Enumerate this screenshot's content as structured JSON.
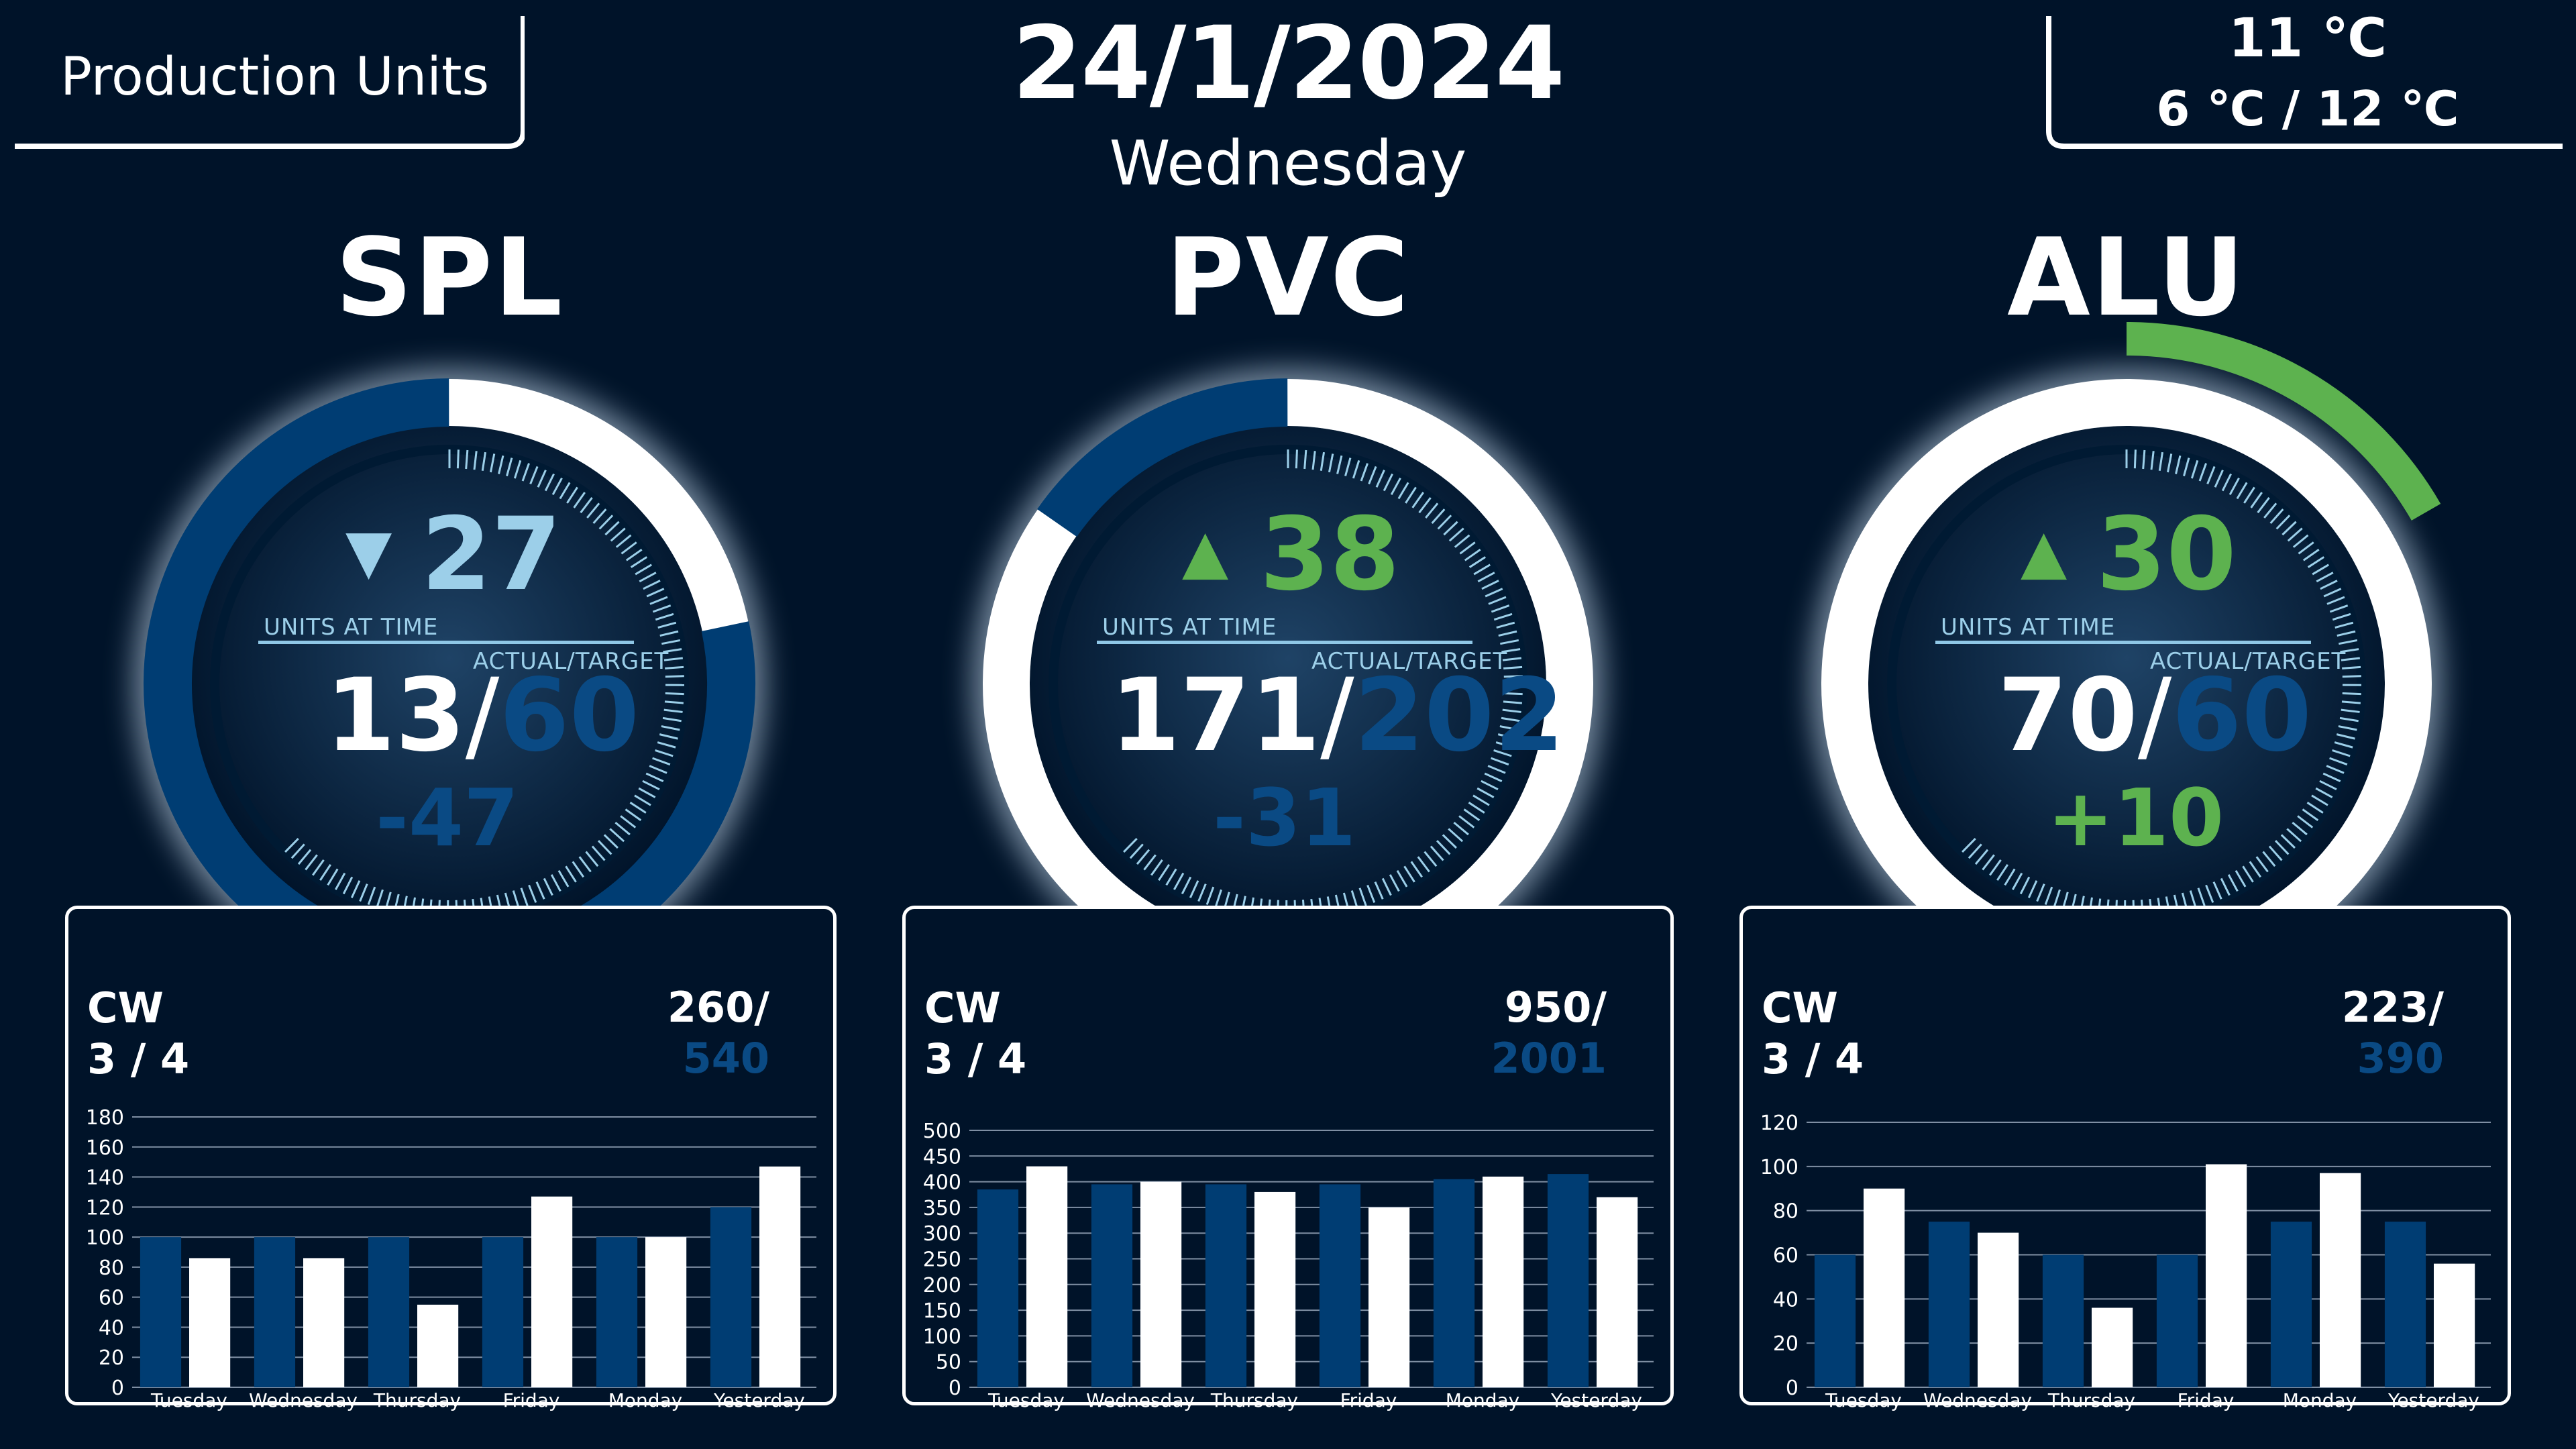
{
  "header": {
    "title": "Production Units",
    "date": "24/1/2024",
    "weekday": "Wednesday",
    "weather": {
      "current": "11 ℃",
      "range": "6 ℃ / 12 ℃"
    }
  },
  "colors": {
    "background": "#001329",
    "navy_bar": "#003d73",
    "white": "#ffffff",
    "light_blue": "#9ccfe9",
    "target_blue": "#0a4a84",
    "green": "#5db24f"
  },
  "units": [
    {
      "name": "SPL",
      "trend_icon": "triangle-down-icon",
      "trend": "down",
      "units_at_time": "27",
      "units_at_time_label": "UNITS AT TIME",
      "actual_target_label": "ACTUAL/TARGET",
      "actual": "13",
      "slash": "/",
      "target": "60",
      "difference": "-47",
      "progress_fraction": 0.217,
      "cw_label": "CW",
      "cw_value": "3 / 4",
      "week_actual": "260/",
      "week_target": "540"
    },
    {
      "name": "PVC",
      "trend_icon": "triangle-up-icon",
      "trend": "up",
      "units_at_time": "38",
      "units_at_time_label": "UNITS AT TIME",
      "actual_target_label": "ACTUAL/TARGET",
      "actual": "171",
      "slash": "/",
      "target": "202",
      "difference": "-31",
      "progress_fraction": 0.847,
      "cw_label": "CW",
      "cw_value": "3 / 4",
      "week_actual": "950/",
      "week_target": "2001"
    },
    {
      "name": "ALU",
      "trend_icon": "triangle-up-icon",
      "trend": "up",
      "units_at_time": "30",
      "units_at_time_label": "UNITS AT TIME",
      "actual_target_label": "ACTUAL/TARGET",
      "actual": "70",
      "slash": "/",
      "target": "60",
      "difference": "+10",
      "progress_fraction": 1.167,
      "cw_label": "CW",
      "cw_value": "3 / 4",
      "week_actual": "223/",
      "week_target": "390"
    }
  ],
  "chart_data": [
    {
      "type": "bar",
      "categories": [
        "Tuesday",
        "Wednesday",
        "Thursday",
        "Friday",
        "Monday",
        "Yesterday"
      ],
      "series": [
        {
          "values": [
            100,
            100,
            100,
            100,
            100,
            120
          ]
        },
        {
          "values": [
            86,
            86,
            55,
            127,
            100,
            147
          ]
        }
      ],
      "yticks": [
        0,
        20,
        40,
        60,
        80,
        100,
        120,
        140,
        160,
        180
      ],
      "ylim": [
        0,
        180
      ],
      "grid": true
    },
    {
      "type": "bar",
      "categories": [
        "Tuesday",
        "Wednesday",
        "Thursday",
        "Friday",
        "Monday",
        "Yesterday"
      ],
      "series": [
        {
          "values": [
            385,
            395,
            395,
            395,
            405,
            415
          ]
        },
        {
          "values": [
            430,
            400,
            380,
            350,
            410,
            370
          ]
        }
      ],
      "yticks": [
        0,
        50,
        100,
        150,
        200,
        250,
        300,
        350,
        400,
        450,
        500
      ],
      "ylim": [
        0,
        500
      ],
      "grid": true
    },
    {
      "type": "bar",
      "categories": [
        "Tuesday",
        "Wednesday",
        "Thursday",
        "Friday",
        "Monday",
        "Yesterday"
      ],
      "series": [
        {
          "values": [
            60,
            75,
            60,
            60,
            75,
            75
          ]
        },
        {
          "values": [
            90,
            70,
            36,
            101,
            97,
            56
          ]
        }
      ],
      "yticks": [
        0,
        20,
        40,
        60,
        80,
        100,
        120
      ],
      "ylim": [
        0,
        120
      ],
      "grid": true
    }
  ]
}
